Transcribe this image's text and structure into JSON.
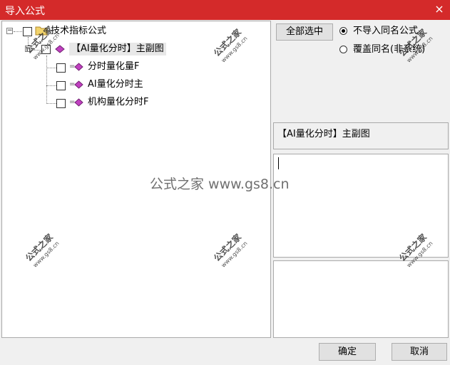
{
  "window": {
    "title": "导入公式",
    "close_glyph": "×",
    "titlebar_color": "#d42a2a"
  },
  "tree": {
    "root": {
      "label": "技术指标公式",
      "expander": "−",
      "icon": "folder-icon"
    },
    "group": {
      "label": "【AI量化分时】主副图",
      "expander": "−"
    },
    "items": [
      {
        "label": "分时量化量F",
        "icon": "formula-icon"
      },
      {
        "label": "AI量化分时主",
        "icon": "formula-icon"
      },
      {
        "label": "机构量化分时F",
        "icon": "formula-icon"
      }
    ]
  },
  "actions": {
    "select_all": "全部选中",
    "radio_skip": "不导入同名公式",
    "radio_overwrite": "覆盖同名(非系统)",
    "radio_selected": "skip"
  },
  "detail": {
    "formula_name": "【AI量化分时】主副图",
    "comment_text": "",
    "info_text": ""
  },
  "footer": {
    "ok": "确定",
    "cancel": "取消"
  },
  "watermark": {
    "brand": "公式之家",
    "url": "www.gs8.cn",
    "center": "公式之家 www.gs8.cn"
  }
}
